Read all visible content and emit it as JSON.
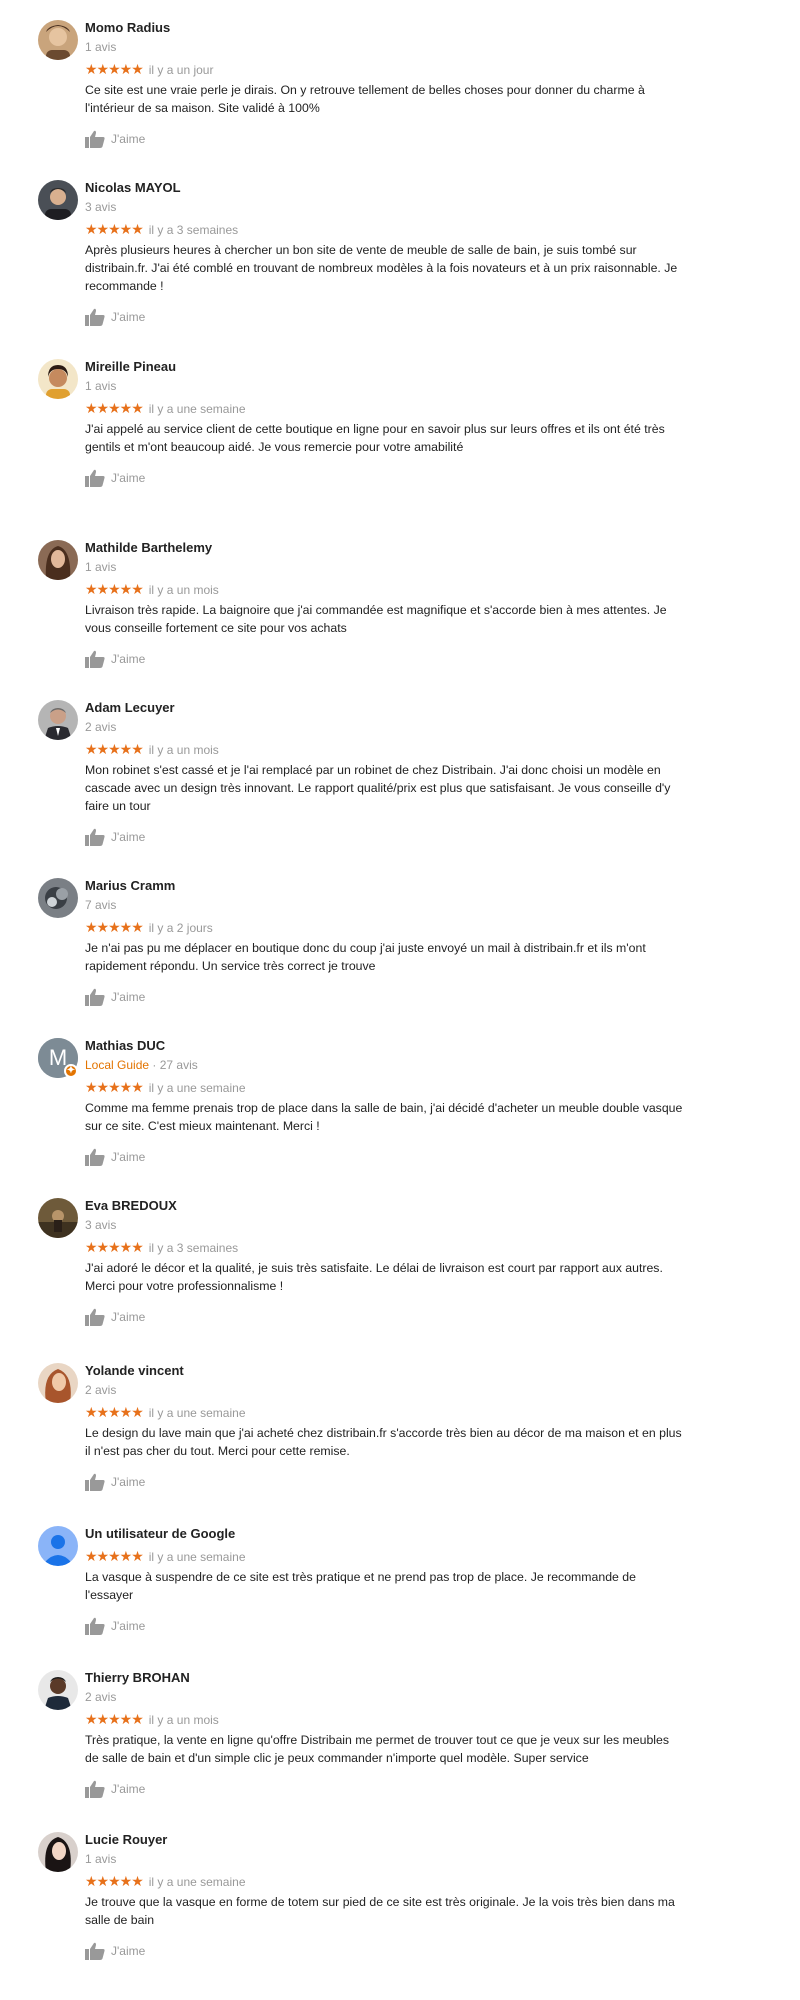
{
  "like_label": "J'aime",
  "colors": {
    "stars": "#e7711b",
    "meta": "#999999",
    "local_guide": "#e37400"
  },
  "reviews": [
    {
      "name": "Momo Radius",
      "count": "1 avis",
      "stars": "★★★★★",
      "time": "il y a un jour",
      "text": "Ce site est une vraie perle je dirais. On y retrouve tellement de belles choses pour donner du charme à l'intérieur de sa maison. Site validé à 100%"
    },
    {
      "name": "Nicolas MAYOL",
      "count": "3 avis",
      "stars": "★★★★★",
      "time": "il y a 3 semaines",
      "text": "Après plusieurs heures à chercher un bon site de vente de meuble de salle de bain, je suis tombé sur distribain.fr. J'ai été comblé en trouvant de nombreux modèles à la fois novateurs et à un prix raisonnable. Je recommande !"
    },
    {
      "name": "Mireille Pineau",
      "count": "1 avis",
      "stars": "★★★★★",
      "time": "il y a une semaine",
      "text": "J'ai appelé au service client de cette boutique en ligne pour en savoir plus sur leurs offres et ils ont été très gentils et m'ont beaucoup aidé. Je vous remercie pour votre amabilité"
    },
    {
      "name": "Mathilde Barthelemy",
      "count": "1 avis",
      "stars": "★★★★★",
      "time": "il y a un mois",
      "text": "Livraison très rapide. La baignoire que j'ai commandée est magnifique et s'accorde bien à mes attentes. Je vous conseille fortement ce site pour vos achats"
    },
    {
      "name": "Adam Lecuyer",
      "count": "2 avis",
      "stars": "★★★★★",
      "time": "il y a un mois",
      "text": "Mon robinet s'est cassé et je l'ai remplacé par un robinet de chez Distribain. J'ai donc choisi un modèle en cascade avec un design très innovant. Le rapport qualité/prix est plus que satisfaisant. Je vous conseille d'y faire un tour"
    },
    {
      "name": "Marius Cramm",
      "count": "7 avis",
      "stars": "★★★★★",
      "time": "il y a 2 jours",
      "text": "Je n'ai pas pu me déplacer en boutique donc du coup j'ai juste envoyé un mail à distribain.fr et ils m'ont rapidement répondu. Un service très correct je trouve"
    },
    {
      "name": "Mathias DUC",
      "local_guide": "Local Guide",
      "count": " · 27 avis",
      "avatar_letter": "M",
      "stars": "★★★★★",
      "time": "il y a une semaine",
      "text": "Comme ma femme prenais trop de place dans la salle de bain, j'ai décidé d'acheter un meuble double vasque sur ce site. C'est mieux maintenant. Merci !"
    },
    {
      "name": "Eva BREDOUX",
      "count": "3 avis",
      "stars": "★★★★★",
      "time": "il y a 3 semaines",
      "text": "J'ai adoré le décor et la qualité, je suis très satisfaite. Le délai de livraison est court par rapport aux autres. Merci pour votre professionnalisme !"
    },
    {
      "name": "Yolande vincent",
      "count": "2 avis",
      "stars": "★★★★★",
      "time": "il y a une semaine",
      "text": "Le design du lave main que j'ai acheté chez distribain.fr s'accorde très bien au décor de ma maison et en plus il n'est pas cher du tout. Merci pour cette remise."
    },
    {
      "name": "Un utilisateur de Google",
      "count": "",
      "stars": "★★★★★",
      "time": "il y a une semaine",
      "text": "La vasque à suspendre de ce site est très pratique et ne prend pas trop de place. Je recommande de l'essayer"
    },
    {
      "name": "Thierry BROHAN",
      "count": "2 avis",
      "stars": "★★★★★",
      "time": "il y a un mois",
      "text": "Très pratique, la vente en ligne qu'offre Distribain me permet de trouver tout ce que je veux sur les meubles de salle de bain et d'un simple clic je peux commander n'importe quel modèle. Super service"
    },
    {
      "name": "Lucie Rouyer",
      "count": "1 avis",
      "stars": "★★★★★",
      "time": "il y a une semaine",
      "text": "Je trouve que la vasque en forme de totem sur pied de ce site est très originale. Je la vois très bien dans ma salle de bain"
    }
  ]
}
